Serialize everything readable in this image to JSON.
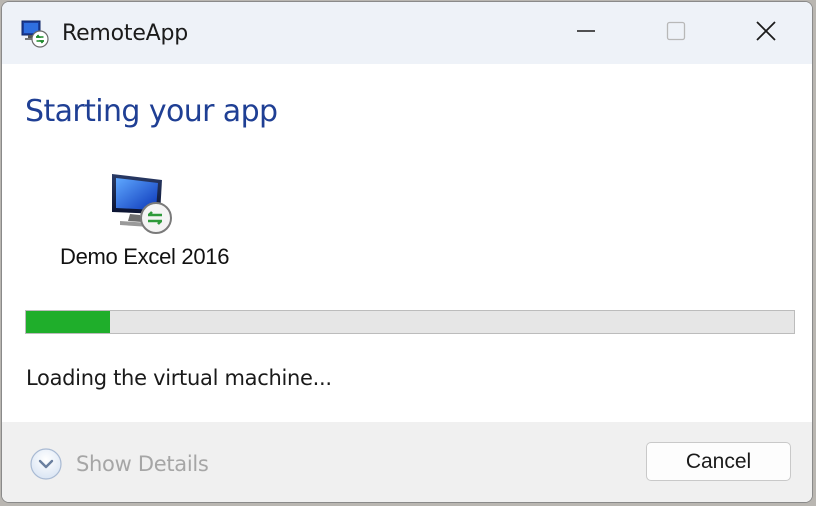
{
  "window": {
    "title": "RemoteApp",
    "app_icon": "remote-desktop-icon"
  },
  "controls": {
    "minimize_icon": "minimize-icon",
    "maximize_icon": "maximize-icon",
    "close_icon": "close-icon"
  },
  "main": {
    "heading": "Starting your app",
    "app_icon": "remote-desktop-monitor-icon",
    "app_name": "Demo Excel 2016",
    "progress_fraction": 0.11,
    "status": "Loading the virtual machine..."
  },
  "footer": {
    "show_details_label": "Show Details",
    "show_details_icon": "chevron-down-circle-icon",
    "cancel_label": "Cancel"
  },
  "colors": {
    "heading": "#1f3f94",
    "progress_fill": "#1fae2b",
    "titlebar": "#eef2f8",
    "footer": "#f0f0f0"
  }
}
